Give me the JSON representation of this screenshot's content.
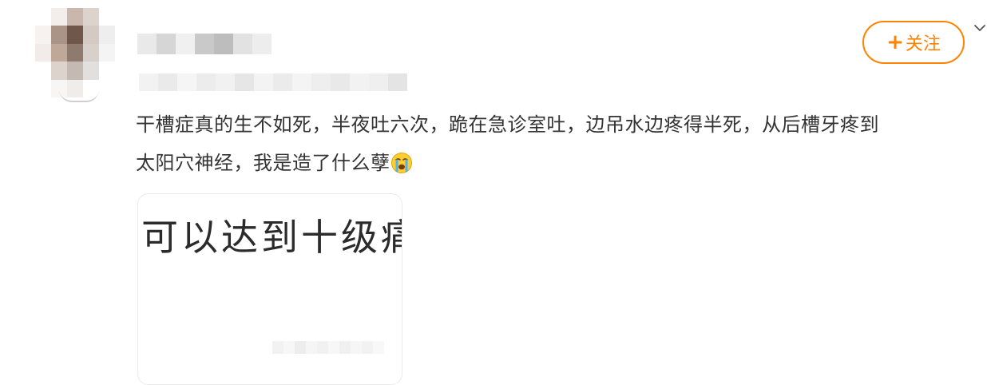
{
  "post": {
    "text_line1": "干槽症真的生不如死，半夜吐六次，跪在急诊室吐，边吊水边疼得半死，从后槽牙疼到",
    "text_line2": "太阳穴神经，我是造了什么孽",
    "emoji": "crying-face-icon"
  },
  "follow_button": {
    "label": "关注",
    "plus": "+"
  },
  "image": {
    "text": "可以达到十级痛"
  },
  "colors": {
    "accent": "#ff8200",
    "text": "#333333"
  },
  "icons": [
    "chevron-down-icon",
    "crying-face-icon",
    "plus-icon"
  ]
}
